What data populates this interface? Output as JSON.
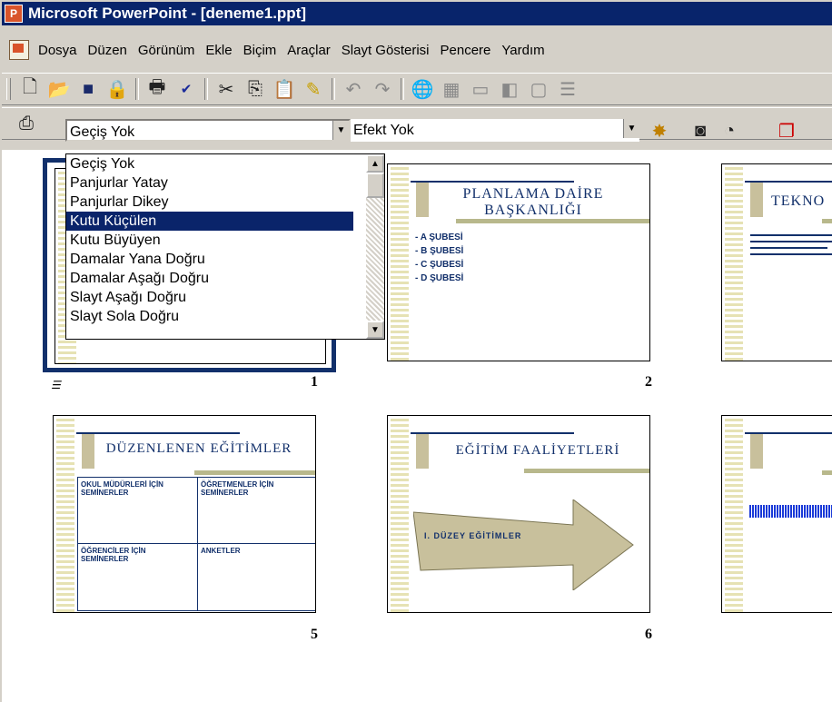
{
  "window": {
    "title": "Microsoft PowerPoint - [deneme1.ppt]"
  },
  "menu": [
    {
      "label": "Dosya"
    },
    {
      "label": "Düzen"
    },
    {
      "label": "Görünüm"
    },
    {
      "label": "Ekle"
    },
    {
      "label": "Biçim"
    },
    {
      "label": "Araçlar"
    },
    {
      "label": "Slayt Gösterisi"
    },
    {
      "label": "Pencere"
    },
    {
      "label": "Yardım"
    }
  ],
  "transition": {
    "selected": "Geçiş Yok",
    "effect": "Efekt Yok",
    "options": [
      "Geçiş Yok",
      "Panjurlar Yatay",
      "Panjurlar Dikey",
      "Kutu Küçülen",
      "Kutu Büyüyen",
      "Damalar Yana Doğru",
      "Damalar Aşağı Doğru",
      "Slayt Aşağı Doğru",
      "Slayt Sola Doğru"
    ],
    "highlighted": "Kutu Küçülen"
  },
  "slides": {
    "s1": {
      "number": "1"
    },
    "s2": {
      "number": "2",
      "title_line1": "PLANLAMA DAİRE",
      "title_line2": "BAŞKANLIĞI",
      "bullets": [
        "- A ŞUBESİ",
        "- B ŞUBESİ",
        "- C ŞUBESİ",
        "- D ŞUBESİ"
      ]
    },
    "s3": {
      "title": "TEKNO"
    },
    "s5": {
      "number": "5",
      "title": "DÜZENLENEN EĞİTİMLER",
      "cells": [
        "OKUL MÜDÜRLERİ İÇİN SEMİNERLER",
        "ÖĞRETMENLER İÇİN SEMİNERLER",
        "ÖĞRENCİLER İÇİN SEMİNERLER",
        "ANKETLER"
      ]
    },
    "s6": {
      "number": "6",
      "title": "EĞİTİM FAALİYETLERİ",
      "arrow_text": "I. DÜZEY EĞİTİMLER"
    }
  }
}
